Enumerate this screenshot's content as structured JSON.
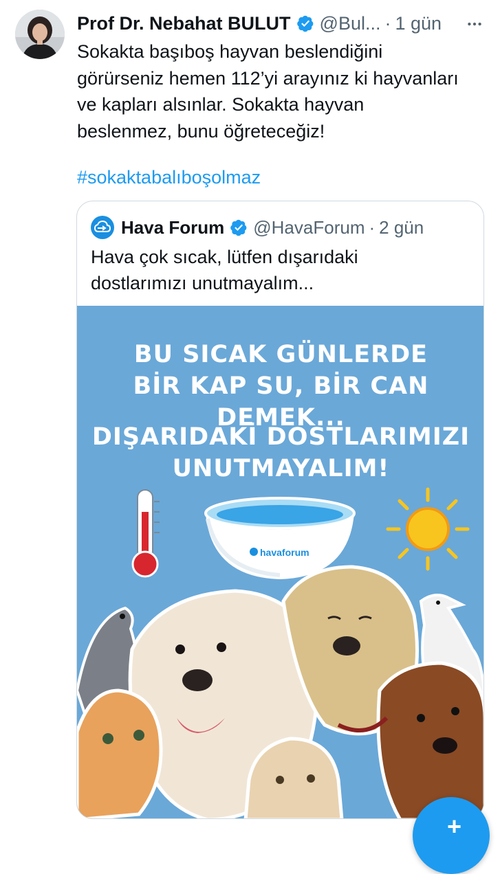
{
  "tweet": {
    "author_name": "Prof Dr. Nebahat BULUT",
    "handle": "@Bul...",
    "separator": "·",
    "time": "1 gün",
    "text": "Sokakta başıboş hayvan beslendiğini\ngörürseniz hemen 112’yi arayınız ki hayvanları\nve kapları alsınlar. Sokakta hayvan\nbeslenmez, bunu öğreteceğiz!",
    "hashtag": "#sokaktabalıboşolmaz",
    "icons": {
      "verified": "verified-badge-icon",
      "more": "more-options-icon",
      "avatar": "avatar"
    }
  },
  "quote": {
    "author_name": "Hava Forum",
    "handle": "@HavaForum",
    "separator": "·",
    "time": "2 gün",
    "text": "Hava çok sıcak, lütfen dışarıdaki\ndostlarımızı unutmayalım...",
    "media": {
      "headline_line1": "BU SICAK GÜNLERDE",
      "headline_line2": "BİR KAP SU, BİR CAN DEMEK...",
      "subline_line1": "DIŞARIDAKİ DOSTLARIMIZI",
      "subline_line2": "UNUTMAYALIM!",
      "bowl_label": "havaforum",
      "background_color": "#6aa8d8"
    }
  },
  "colors": {
    "text_primary": "#0f1419",
    "text_secondary": "#536471",
    "link": "#1d9bf0",
    "verified": "#1d9bf0",
    "border": "#cfd9de"
  },
  "fab": {
    "icon": "compose-plus-icon"
  }
}
